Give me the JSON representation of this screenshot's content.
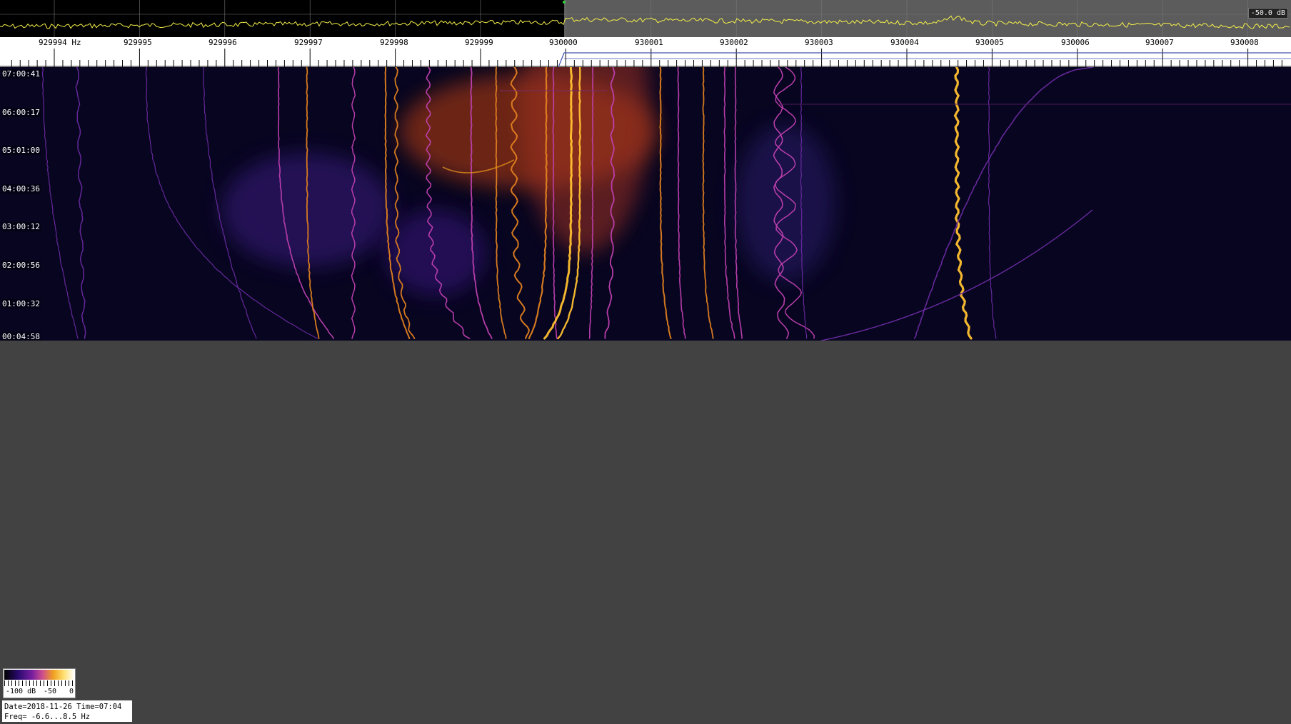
{
  "spectrum": {
    "db_readout": "-50.0 dB"
  },
  "freq_axis": {
    "labels": [
      "929994 Hz",
      "929995",
      "929996",
      "929997",
      "929998",
      "929999",
      "930000",
      "930001",
      "930002",
      "930003",
      "930004",
      "930005",
      "930006",
      "930007",
      "930008"
    ]
  },
  "waterfall": {
    "time_labels": [
      "07:00:41",
      "06:00:17",
      "05:01:00",
      "04:00:36",
      "03:00:12",
      "02:00:56",
      "01:00:32",
      "00:04:58"
    ]
  },
  "colorbar": {
    "min_label": "-100 dB",
    "mid_label": "-50",
    "max_label": "0"
  },
  "info": {
    "date_time": "Date=2018-11-26 Time=07:04",
    "freq_range": "Freq= -6.6...8.5 Hz"
  },
  "colors": {
    "spectrum_trace": "#f5f04a",
    "background": "#424242",
    "waterfall_bg": "#070520",
    "signal_hot": "#ffb020",
    "signal_mid": "#c040c0",
    "signal_weak": "#5a2a9a"
  }
}
